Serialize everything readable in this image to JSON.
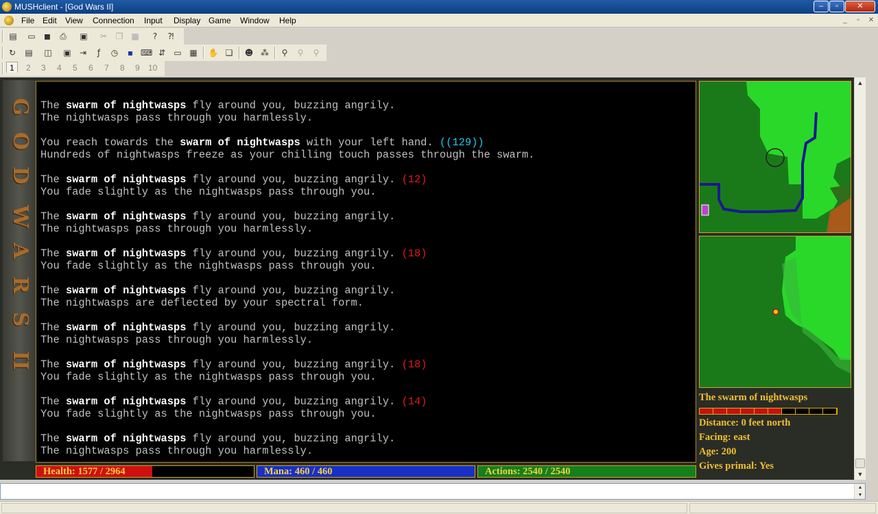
{
  "window": {
    "title": "MUSHclient - [God Wars II]",
    "controls": {
      "minimize": "–",
      "maximize": "▫",
      "close": "✕"
    }
  },
  "menubar": {
    "items": [
      "File",
      "Edit",
      "View",
      "Connection",
      "Input",
      "Display",
      "Game",
      "Window",
      "Help"
    ],
    "mdi_controls": {
      "minimize": "_",
      "restore": "▫",
      "close": "✕"
    }
  },
  "toolbar1": {
    "icons": [
      "new-document-icon",
      "open-folder-icon",
      "save-icon",
      "print-icon",
      "print-preview-icon",
      "cut-icon",
      "copy-icon",
      "paste-icon",
      "help-icon",
      "context-help-icon"
    ]
  },
  "toolbar2": {
    "icons": [
      "reconnect-icon",
      "document-icon",
      "split-icon",
      "configure-icon",
      "send-icon",
      "functions-icon",
      "clock-icon",
      "monitor-icon",
      "macros-icon",
      "aliases-icon",
      "list-icon",
      "table-icon",
      "hand-icon",
      "stack-icon",
      "user-icon",
      "paws-icon",
      "find-icon",
      "find-next-icon",
      "find-prev-icon"
    ]
  },
  "world_tabs": {
    "items": [
      "1",
      "2",
      "3",
      "4",
      "5",
      "6",
      "7",
      "8",
      "9",
      "10"
    ],
    "active": "1"
  },
  "banner": {
    "glyphs": [
      "G",
      "O",
      "D",
      "W",
      "A",
      "R",
      "S",
      "II"
    ],
    "color": "#a86b2a"
  },
  "output": {
    "lines": [
      {
        "segments": [
          {
            "t": "The ",
            "c": "n"
          },
          {
            "t": "swarm of nightwasps",
            "c": "hl"
          },
          {
            "t": " fly around you, buzzing angrily.",
            "c": "n"
          }
        ]
      },
      {
        "segments": [
          {
            "t": "The nightwasps pass through you harmlessly.",
            "c": "n"
          }
        ]
      },
      {
        "segments": []
      },
      {
        "segments": [
          {
            "t": "You reach towards the ",
            "c": "n"
          },
          {
            "t": "swarm of nightwasps",
            "c": "hl"
          },
          {
            "t": " with your left hand. ",
            "c": "n"
          },
          {
            "t": "((129))",
            "c": "num-cyan"
          }
        ]
      },
      {
        "segments": [
          {
            "t": "Hundreds of nightwasps freeze as your chilling touch passes through the swarm.",
            "c": "n"
          }
        ]
      },
      {
        "segments": []
      },
      {
        "segments": [
          {
            "t": "The ",
            "c": "n"
          },
          {
            "t": "swarm of nightwasps",
            "c": "hl"
          },
          {
            "t": " fly around you, buzzing angrily. ",
            "c": "n"
          },
          {
            "t": "(12)",
            "c": "num-red"
          }
        ]
      },
      {
        "segments": [
          {
            "t": "You fade slightly as the nightwasps pass through you.",
            "c": "n"
          }
        ]
      },
      {
        "segments": []
      },
      {
        "segments": [
          {
            "t": "The ",
            "c": "n"
          },
          {
            "t": "swarm of nightwasps",
            "c": "hl"
          },
          {
            "t": " fly around you, buzzing angrily.",
            "c": "n"
          }
        ]
      },
      {
        "segments": [
          {
            "t": "The nightwasps pass through you harmlessly.",
            "c": "n"
          }
        ]
      },
      {
        "segments": []
      },
      {
        "segments": [
          {
            "t": "The ",
            "c": "n"
          },
          {
            "t": "swarm of nightwasps",
            "c": "hl"
          },
          {
            "t": " fly around you, buzzing angrily. ",
            "c": "n"
          },
          {
            "t": "(18)",
            "c": "num-red"
          }
        ]
      },
      {
        "segments": [
          {
            "t": "You fade slightly as the nightwasps pass through you.",
            "c": "n"
          }
        ]
      },
      {
        "segments": []
      },
      {
        "segments": [
          {
            "t": "The ",
            "c": "n"
          },
          {
            "t": "swarm of nightwasps",
            "c": "hl"
          },
          {
            "t": " fly around you, buzzing angrily.",
            "c": "n"
          }
        ]
      },
      {
        "segments": [
          {
            "t": "The nightwasps are deflected by your spectral form.",
            "c": "n"
          }
        ]
      },
      {
        "segments": []
      },
      {
        "segments": [
          {
            "t": "The ",
            "c": "n"
          },
          {
            "t": "swarm of nightwasps",
            "c": "hl"
          },
          {
            "t": " fly around you, buzzing angrily.",
            "c": "n"
          }
        ]
      },
      {
        "segments": [
          {
            "t": "The nightwasps pass through you harmlessly.",
            "c": "n"
          }
        ]
      },
      {
        "segments": []
      },
      {
        "segments": [
          {
            "t": "The ",
            "c": "n"
          },
          {
            "t": "swarm of nightwasps",
            "c": "hl"
          },
          {
            "t": " fly around you, buzzing angrily. ",
            "c": "n"
          },
          {
            "t": "(18)",
            "c": "num-red"
          }
        ]
      },
      {
        "segments": [
          {
            "t": "You fade slightly as the nightwasps pass through you.",
            "c": "n"
          }
        ]
      },
      {
        "segments": []
      },
      {
        "segments": [
          {
            "t": "The ",
            "c": "n"
          },
          {
            "t": "swarm of nightwasps",
            "c": "hl"
          },
          {
            "t": " fly around you, buzzing angrily. ",
            "c": "n"
          },
          {
            "t": "(14)",
            "c": "num-red"
          }
        ]
      },
      {
        "segments": [
          {
            "t": "You fade slightly as the nightwasps pass through you.",
            "c": "n"
          }
        ]
      },
      {
        "segments": []
      },
      {
        "segments": [
          {
            "t": "The ",
            "c": "n"
          },
          {
            "t": "swarm of nightwasps",
            "c": "hl"
          },
          {
            "t": " fly around you, buzzing angrily.",
            "c": "n"
          }
        ]
      },
      {
        "segments": [
          {
            "t": "The nightwasps pass through you harmlessly.",
            "c": "n"
          }
        ]
      }
    ]
  },
  "target": {
    "name": "The swarm of nightwasps",
    "health_segments_filled": 6,
    "health_segments_total": 10,
    "distance": "Distance: 0 feet north",
    "facing": "Facing: east",
    "age": "Age: 200",
    "gives_primal": "Gives primal: Yes"
  },
  "stats": {
    "health": {
      "label": "Health: 1577 / 2964",
      "fraction": 0.532,
      "color": "#d01010"
    },
    "mana": {
      "label": "Mana: 460 / 460",
      "fraction": 1.0,
      "color": "#1830c8"
    },
    "actions": {
      "label": "Actions: 2540 / 2540",
      "fraction": 1.0,
      "color": "#14801c"
    }
  },
  "colors": {
    "grass_dark": "#1a7a1a",
    "grass_light": "#22dd22",
    "river": "#1a1a8a",
    "dirt": "#a85a1a",
    "text_gold": "#f0c030"
  },
  "input": {
    "value": ""
  }
}
